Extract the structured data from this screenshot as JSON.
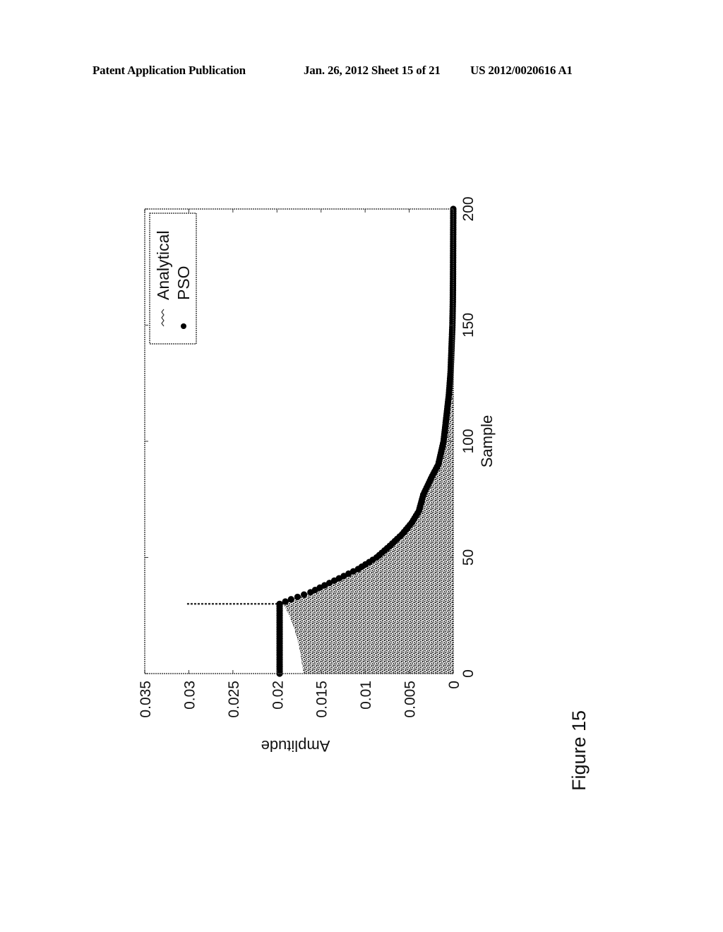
{
  "header": {
    "left": "Patent Application Publication",
    "middle": "Jan. 26, 2012  Sheet 15 of 21",
    "right": "US 2012/0020616 A1"
  },
  "figure_label": "Figure 15",
  "chart_data": {
    "type": "line",
    "orientation": "rotated 90 degrees counter-clockwise on page",
    "title": "",
    "xlabel": "Sample",
    "ylabel": "Amplitude",
    "xlim": [
      0,
      200
    ],
    "ylim": [
      0,
      0.035
    ],
    "xticks": [
      0,
      50,
      100,
      150,
      200
    ],
    "xtick_labels": [
      "0",
      "50",
      "100",
      "150",
      "200"
    ],
    "yticks": [
      0,
      0.005,
      0.01,
      0.015,
      0.02,
      0.025,
      0.03,
      0.035
    ],
    "ytick_labels": [
      "0",
      "0.005",
      "0.01",
      "0.015",
      "0.02",
      "0.025",
      "0.03",
      "0.035"
    ],
    "grid": false,
    "legend": {
      "placement": "top-right",
      "entries": [
        "Analytical",
        "PSO"
      ]
    },
    "series": [
      {
        "name": "Analytical",
        "style": "dense noisy stems (filled region) with outlier spike",
        "x": [
          0,
          5,
          10,
          15,
          20,
          25,
          28,
          30,
          32,
          35,
          40,
          45,
          50,
          60,
          70,
          80,
          90,
          100,
          120,
          150,
          200
        ],
        "envelope_min": [
          0.017,
          0.0172,
          0.0174,
          0.0177,
          0.0181,
          0.0186,
          0.019,
          0.0193,
          0.0184,
          0.0162,
          0.0135,
          0.0108,
          0.0087,
          0.0058,
          0.0039,
          0.0026,
          0.0017,
          0.0011,
          0.0005,
          0.0001,
          0.0
        ],
        "spike": {
          "x": 30,
          "y": 0.0302
        }
      },
      {
        "name": "PSO",
        "style": "filled circle markers",
        "x": [
          0,
          5,
          10,
          15,
          20,
          25,
          30,
          32,
          35,
          38,
          40,
          45,
          50,
          55,
          60,
          65,
          70,
          77,
          85,
          90,
          100,
          110,
          120,
          130,
          140,
          150,
          160,
          170,
          180,
          190,
          200
        ],
        "values": [
          0.0197,
          0.0197,
          0.0197,
          0.0197,
          0.0197,
          0.0197,
          0.0197,
          0.0184,
          0.0162,
          0.0146,
          0.0135,
          0.0108,
          0.0087,
          0.0072,
          0.0058,
          0.0047,
          0.0039,
          0.0034,
          0.0024,
          0.0017,
          0.0011,
          0.0008,
          0.0005,
          0.0003,
          0.0002,
          0.0001,
          5e-05,
          3e-05,
          2e-05,
          1e-05,
          0.0
        ]
      }
    ]
  }
}
